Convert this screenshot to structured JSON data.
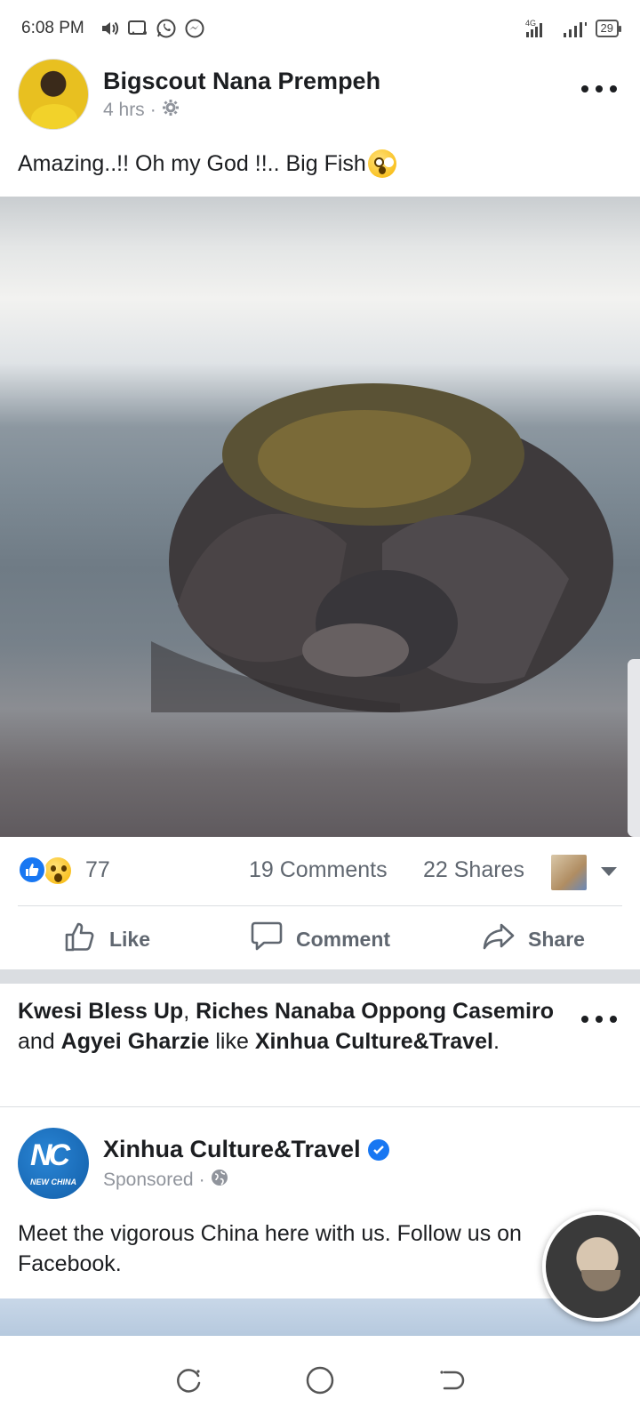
{
  "status_bar": {
    "time": "6:08 PM",
    "network": "4G",
    "battery": "29",
    "icons_left": [
      "volume-icon",
      "screen-cast-icon",
      "whatsapp-icon",
      "messenger-icon"
    ]
  },
  "post": {
    "author": "Bigscout Nana Prempeh",
    "time": "4 hrs",
    "privacy_icon": "gear-icon",
    "text": "Amazing..!! Oh my God !!.. Big Fish",
    "emoji": "astonished-face",
    "reactions_count": "77",
    "comments": "19 Comments",
    "shares": "22 Shares",
    "reaction_types": [
      "like",
      "wow"
    ]
  },
  "actions": {
    "like": "Like",
    "comment": "Comment",
    "share": "Share"
  },
  "suggestion": {
    "friend1": "Kwesi Bless Up",
    "sep": ", ",
    "friend2": "Riches Nanaba Oppong Casemiro",
    "and": " and ",
    "friend3": "Agyei Gharzie",
    "like_word": " like ",
    "page": "Xinhua Culture&Travel",
    "end": "."
  },
  "ad": {
    "page_name": "Xinhua Culture&Travel",
    "logo_text": "NC",
    "logo_label": "NEW CHINA",
    "sponsored": "Sponsored",
    "text": "Meet the vigorous China here with us. Follow us on Facebook."
  },
  "colors": {
    "brand_blue": "#1877f2",
    "text": "#1c1e21",
    "secondary": "#606770",
    "divider": "#dadde1"
  }
}
